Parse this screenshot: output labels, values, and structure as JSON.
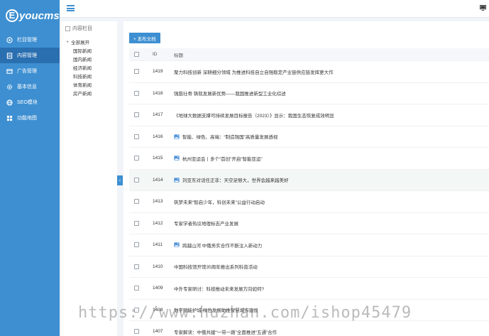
{
  "brand": {
    "logo_letter": "E",
    "logo_text": "youcms"
  },
  "sidebar": {
    "items": [
      {
        "label": "栏目管理",
        "icon": "sitemap-icon"
      },
      {
        "label": "内容管理",
        "icon": "document-icon"
      },
      {
        "label": "广告管理",
        "icon": "ad-icon"
      },
      {
        "label": "基本信息",
        "icon": "settings-icon"
      },
      {
        "label": "SEO模块",
        "icon": "seo-icon"
      },
      {
        "label": "功能地图",
        "icon": "grid-icon"
      }
    ]
  },
  "tree": {
    "header": "内容栏目",
    "root_label": "全部展开",
    "children": [
      "国际新闻",
      "国内新闻",
      "经济新闻",
      "科技新闻",
      "体育新闻",
      "房产新闻"
    ]
  },
  "toolbar": {
    "add_label": "+ 发布文档"
  },
  "table": {
    "headers": {
      "id": "ID",
      "title": "标题"
    },
    "rows": [
      {
        "id": "1419",
        "title": "聚力科技创新 深耕细分领域 为推进科技自立自强稳定产业链供应链发挥更大作",
        "image": false
      },
      {
        "id": "1418",
        "title": "强筋壮骨 铸就发展新优势——我国推进新型工业化综述",
        "image": false
      },
      {
        "id": "1417",
        "title": "《地球大数据支撑可持续发展目标报告（2023）》显示：我国生态恢复成效明显",
        "image": false
      },
      {
        "id": "1416",
        "title": "智能、绿色、高端：“制造强国”高质量发展透视",
        "image": true
      },
      {
        "id": "1415",
        "title": "杭州亚运会丨多个“首创”开启“智能亚运”",
        "image": true
      },
      {
        "id": "1414",
        "title": "刘亚东对话任正非：天空足够大，世界会越来越美好",
        "image": true
      },
      {
        "id": "1413",
        "title": "筑梦未来“智启少年，科创未来”公益行动启动",
        "image": false
      },
      {
        "id": "1412",
        "title": "专家学者热议地理标志产业发展",
        "image": false
      },
      {
        "id": "1411",
        "title": "跨越山河 中俄务实合作不断注入新动力",
        "image": true
      },
      {
        "id": "1410",
        "title": "中国科技馆开馆35周年推出系列科普活动",
        "image": false
      },
      {
        "id": "1409",
        "title": "中外专家研讨：科技推动未来发展方向如何?",
        "image": false
      },
      {
        "id": "1408",
        "title": "数字赋能护城 绿色发展助推智慧城市建设",
        "image": false
      },
      {
        "id": "1407",
        "title": "专家解读：中俄共建“一带一路”全面推进“五通”合作",
        "image": false
      }
    ]
  },
  "watermark": "https://www.huzhan.com/ishop45479",
  "colors": {
    "primary": "#3d8fd1",
    "primary_dark": "#2a6fb0"
  }
}
